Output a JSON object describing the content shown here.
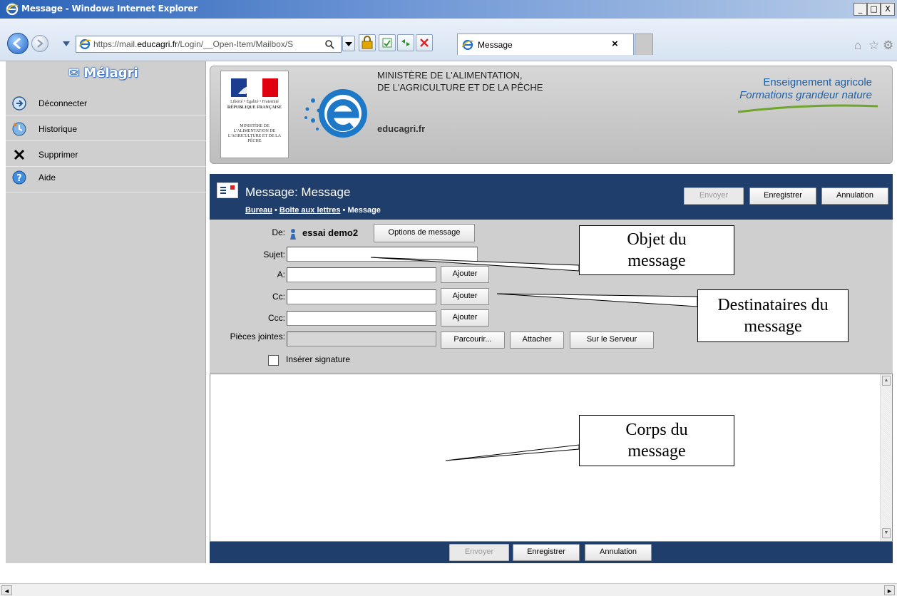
{
  "window": {
    "title": "Message - Windows Internet Explorer",
    "controls": [
      "_",
      "□",
      "X"
    ]
  },
  "browser": {
    "url_prefix": "https://mail.",
    "url_domain": "educagri.fr",
    "url_rest": "/Login/__Open-Item/Mailbox/S",
    "tab_title": "Message",
    "tab_close": "×"
  },
  "sidebar": {
    "brand": "✉ Mélagri",
    "items": [
      {
        "label": "Déconnecter",
        "icon": "logout-icon"
      },
      {
        "label": "Historique",
        "icon": "history-icon"
      },
      {
        "label": "Supprimer",
        "icon": "delete-icon"
      },
      {
        "label": "Aide",
        "icon": "help-icon"
      }
    ]
  },
  "banner": {
    "ministry_line1": "MINISTÈRE DE L'ALIMENTATION,",
    "ministry_line2": "DE L'AGRICULTURE ET DE LA PÊCHE",
    "domain": "educagri.fr",
    "enseignement": "Enseignement agricole",
    "slogan": "Formations grandeur nature",
    "rf_motto": "Liberté • Égalité • Fraternité",
    "rf_republique": "RÉPUBLIQUE FRANÇAISE",
    "rf_ministere": "MINISTÈRE DE L'ALIMENTATION DE L'AGRICULTURE ET DE LA PÊCHE"
  },
  "compose": {
    "title": "Message: Message",
    "breadcrumb": {
      "bureau": "Bureau",
      "sep1": " • ",
      "mailbox": "Boîte aux lettres",
      "sep2": " • ",
      "current": "Message"
    },
    "buttons": {
      "send": "Envoyer",
      "save": "Enregistrer",
      "cancel": "Annulation"
    }
  },
  "form": {
    "from_label": "De:",
    "from_value": "essai demo2",
    "options_button": "Options de message",
    "subject_label": "Sujet:",
    "subject_value": "",
    "to_label": "A:",
    "to_value": "",
    "cc_label": "Cc:",
    "cc_value": "",
    "bcc_label": "Ccc:",
    "bcc_value": "",
    "add_button": "Ajouter",
    "attachments_label": "Pièces jointes:",
    "browse_button": "Parcourir...",
    "attach_button": "Attacher",
    "server_button": "Sur le Serveur",
    "signature_label": "Insérer signature"
  },
  "annotations": {
    "subject_note_line1": "Objet du",
    "subject_note_line2": "message",
    "recipients_note_line1": "Destinataires du",
    "recipients_note_line2": "message",
    "body_note_line1": "Corps du",
    "body_note_line2": "message"
  },
  "colors": {
    "navy": "#1f3e6b",
    "sidebar_gray": "#cfcfcf",
    "brand_blue": "#2f6bbd",
    "enseignement_blue": "#1f5fa5"
  }
}
